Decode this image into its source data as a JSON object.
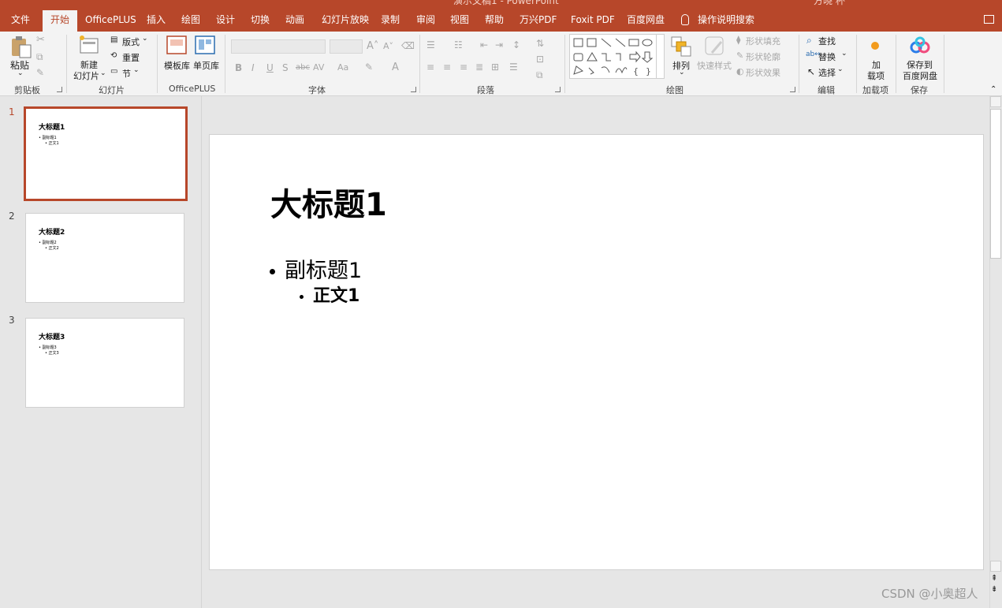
{
  "window": {
    "title": "演示文稿1 - PowerPoint",
    "user": "方晓 杯"
  },
  "tabs": [
    {
      "label": "文件"
    },
    {
      "label": "开始"
    },
    {
      "label": "OfficePLUS"
    },
    {
      "label": "插入"
    },
    {
      "label": "绘图"
    },
    {
      "label": "设计"
    },
    {
      "label": "切换"
    },
    {
      "label": "动画"
    },
    {
      "label": "幻灯片放映"
    },
    {
      "label": "录制"
    },
    {
      "label": "审阅"
    },
    {
      "label": "视图"
    },
    {
      "label": "帮助"
    },
    {
      "label": "万兴PDF"
    },
    {
      "label": "Foxit PDF"
    },
    {
      "label": "百度网盘"
    }
  ],
  "search": {
    "label": "操作说明搜索"
  },
  "ribbon": {
    "clipboard": {
      "paste": "粘贴",
      "group": "剪贴板"
    },
    "slides": {
      "new_slide_line1": "新建",
      "new_slide_line2": "幻灯片",
      "layout": "版式",
      "reset": "重置",
      "section": "节",
      "group": "幻灯片"
    },
    "officeplus": {
      "template": "模板库",
      "single_page": "单页库",
      "group": "OfficePLUS"
    },
    "font": {
      "group": "字体",
      "bold": "B",
      "italic": "I",
      "underline": "U",
      "shadow": "S",
      "strike": "abc",
      "spacing": "AV",
      "case": "Aa"
    },
    "paragraph": {
      "group": "段落"
    },
    "drawing": {
      "arrange": "排列",
      "quick_styles": "快速样式",
      "fill": "形状填充",
      "outline": "形状轮廓",
      "effects": "形状效果",
      "group": "绘图"
    },
    "editing": {
      "find": "查找",
      "replace": "替换",
      "select": "选择",
      "group": "编辑"
    },
    "addins": {
      "line1": "加",
      "line2": "载项",
      "group": "加载项"
    },
    "save": {
      "line1": "保存到",
      "line2": "百度网盘",
      "group": "保存"
    }
  },
  "slides": [
    {
      "num": "1",
      "title": "大标题1",
      "subtitle": "副标题1",
      "body": "正文1"
    },
    {
      "num": "2",
      "title": "大标题2",
      "subtitle": "副标题2",
      "body": "正文2"
    },
    {
      "num": "3",
      "title": "大标题3",
      "subtitle": "副标题3",
      "body": "正文3"
    }
  ],
  "current_slide": {
    "title": "大标题1",
    "subtitle": "副标题1",
    "body": "正文1"
  },
  "watermark": "CSDN @小奥超人",
  "colors": {
    "accent": "#b7472a",
    "ribbon_bg": "#f3f3f3",
    "workspace_bg": "#e6e6e6"
  }
}
